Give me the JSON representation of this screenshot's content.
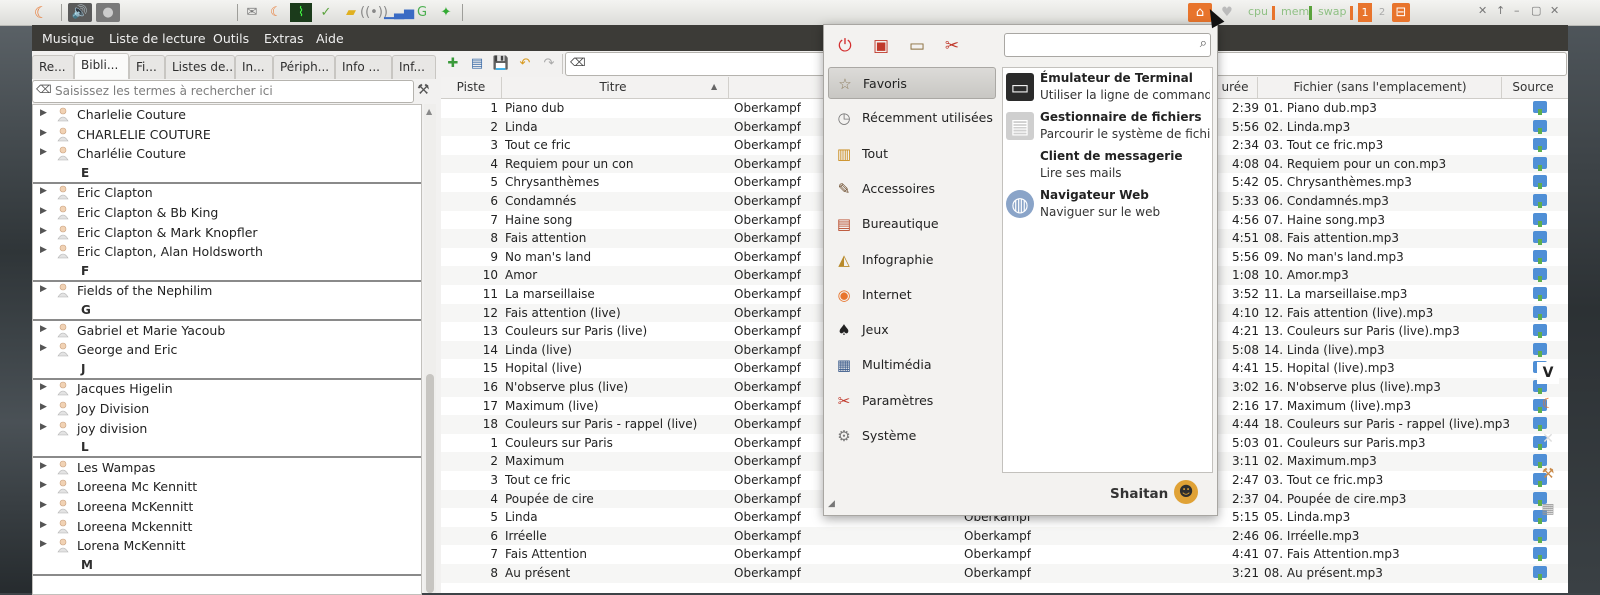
{
  "panel": {
    "cpu_label": "cpu",
    "mem_label": "mem",
    "swap_label": "swap",
    "workspace_number": "1",
    "icons": [
      "mango-icon",
      "volume-icon",
      "record-icon",
      "mail-icon",
      "system-monitor-icon",
      "shield-icon",
      "note-icon",
      "wifi-icon",
      "signal-bars-icon",
      "update-icon",
      "battery-icon"
    ]
  },
  "menubar": {
    "items": [
      "Musique",
      "Liste de lecture",
      "Outils",
      "Extras",
      "Aide"
    ]
  },
  "left": {
    "tabs": [
      "Re...",
      "Bibli...",
      "Fi...",
      "Listes de...",
      "In...",
      "Périph...",
      "Info ...",
      "Inf..."
    ],
    "search_placeholder": "Saisissez les termes à rechercher ici",
    "tree": [
      {
        "type": "artist",
        "label": "Charlelie Couture"
      },
      {
        "type": "artist",
        "label": "CHARLELIE COUTURE"
      },
      {
        "type": "artist",
        "label": "Charlélie Couture"
      },
      {
        "type": "letter",
        "label": "E"
      },
      {
        "type": "artist",
        "label": "Eric Clapton"
      },
      {
        "type": "artist",
        "label": "Eric Clapton & Bb King"
      },
      {
        "type": "artist",
        "label": "Eric Clapton & Mark Knopfler"
      },
      {
        "type": "artist",
        "label": "Eric Clapton, Alan Holdsworth"
      },
      {
        "type": "letter",
        "label": "F"
      },
      {
        "type": "artist",
        "label": "Fields of the Nephilim"
      },
      {
        "type": "letter",
        "label": "G"
      },
      {
        "type": "artist",
        "label": "Gabriel et Marie Yacoub"
      },
      {
        "type": "artist",
        "label": "George and Eric"
      },
      {
        "type": "letter",
        "label": "J"
      },
      {
        "type": "artist",
        "label": "Jacques Higelin"
      },
      {
        "type": "artist",
        "label": "Joy Division"
      },
      {
        "type": "artist",
        "label": "joy division"
      },
      {
        "type": "letter",
        "label": "L"
      },
      {
        "type": "artist",
        "label": "Les Wampas"
      },
      {
        "type": "artist",
        "label": "Loreena Mc Kennitt"
      },
      {
        "type": "artist",
        "label": "Loreena McKennitt"
      },
      {
        "type": "artist",
        "label": "Loreena Mckennitt"
      },
      {
        "type": "artist",
        "label": "Lorena McKennitt"
      },
      {
        "type": "letter",
        "label": "M"
      }
    ]
  },
  "grid": {
    "columns": {
      "track": "Piste",
      "title": "Titre",
      "duration": "urée",
      "file": "Fichier (sans l'emplacement)",
      "source": "Source"
    },
    "sorted_column": "Titre",
    "rows": [
      {
        "n": "1",
        "title": "Piano dub",
        "artist": "Oberkampf",
        "album": "",
        "dur": "2:39",
        "file": "01. Piano dub.mp3"
      },
      {
        "n": "2",
        "title": "Linda",
        "artist": "Oberkampf",
        "album": "",
        "dur": "5:56",
        "file": "02. Linda.mp3"
      },
      {
        "n": "3",
        "title": "Tout ce fric",
        "artist": "Oberkampf",
        "album": "",
        "dur": "2:34",
        "file": "03. Tout ce fric.mp3"
      },
      {
        "n": "4",
        "title": "Requiem pour un con",
        "artist": "Oberkampf",
        "album": "",
        "dur": "4:08",
        "file": "04. Requiem pour un con.mp3"
      },
      {
        "n": "5",
        "title": "Chrysanthèmes",
        "artist": "Oberkampf",
        "album": "",
        "dur": "5:42",
        "file": "05. Chrysanthèmes.mp3"
      },
      {
        "n": "6",
        "title": "Condamnés",
        "artist": "Oberkampf",
        "album": "",
        "dur": "5:33",
        "file": "06. Condamnés.mp3"
      },
      {
        "n": "7",
        "title": "Haine song",
        "artist": "Oberkampf",
        "album": "",
        "dur": "4:56",
        "file": "07. Haine song.mp3"
      },
      {
        "n": "8",
        "title": "Fais attention",
        "artist": "Oberkampf",
        "album": "",
        "dur": "4:51",
        "file": "08. Fais attention.mp3"
      },
      {
        "n": "9",
        "title": "No man's land",
        "artist": "Oberkampf",
        "album": "",
        "dur": "5:56",
        "file": "09. No man's land.mp3"
      },
      {
        "n": "10",
        "title": "Amor",
        "artist": "Oberkampf",
        "album": "",
        "dur": "1:08",
        "file": "10. Amor.mp3"
      },
      {
        "n": "11",
        "title": "La marseillaise",
        "artist": "Oberkampf",
        "album": "",
        "dur": "3:52",
        "file": "11. La marseillaise.mp3"
      },
      {
        "n": "12",
        "title": "Fais attention (live)",
        "artist": "Oberkampf",
        "album": "",
        "dur": "4:10",
        "file": "12. Fais attention (live).mp3"
      },
      {
        "n": "13",
        "title": "Couleurs sur Paris (live)",
        "artist": "Oberkampf",
        "album": "",
        "dur": "4:21",
        "file": "13. Couleurs sur Paris (live).mp3"
      },
      {
        "n": "14",
        "title": "Linda (live)",
        "artist": "Oberkampf",
        "album": "",
        "dur": "5:08",
        "file": "14. Linda (live).mp3"
      },
      {
        "n": "15",
        "title": "Hopital (live)",
        "artist": "Oberkampf",
        "album": "",
        "dur": "4:41",
        "file": "15. Hopital (live).mp3"
      },
      {
        "n": "16",
        "title": "N'observe plus (live)",
        "artist": "Oberkampf",
        "album": "",
        "dur": "3:02",
        "file": "16. N'observe plus (live).mp3"
      },
      {
        "n": "17",
        "title": "Maximum (live)",
        "artist": "Oberkampf",
        "album": "",
        "dur": "2:16",
        "file": "17. Maximum (live).mp3"
      },
      {
        "n": "18",
        "title": "Couleurs sur Paris - rappel (live)",
        "artist": "Oberkampf",
        "album": "",
        "dur": "4:44",
        "file": "18. Couleurs sur Paris - rappel (live).mp3"
      },
      {
        "n": "1",
        "title": "Couleurs sur Paris",
        "artist": "Oberkampf",
        "album": "",
        "dur": "5:03",
        "file": "01. Couleurs sur Paris.mp3"
      },
      {
        "n": "2",
        "title": "Maximum",
        "artist": "Oberkampf",
        "album": "",
        "dur": "3:11",
        "file": "02. Maximum.mp3"
      },
      {
        "n": "3",
        "title": "Tout ce fric",
        "artist": "Oberkampf",
        "album": "",
        "dur": "2:47",
        "file": "03. Tout ce fric.mp3"
      },
      {
        "n": "4",
        "title": "Poupée de cire",
        "artist": "Oberkampf",
        "album": "",
        "dur": "2:37",
        "file": "04. Poupée de cire.mp3"
      },
      {
        "n": "5",
        "title": "Linda",
        "artist": "Oberkampf",
        "album": "Oberkampf",
        "dur": "5:15",
        "file": "05. Linda.mp3"
      },
      {
        "n": "6",
        "title": "Irréelle",
        "artist": "Oberkampf",
        "album": "Oberkampf",
        "dur": "2:46",
        "file": "06. Irréelle.mp3"
      },
      {
        "n": "7",
        "title": "Fais Attention",
        "artist": "Oberkampf",
        "album": "Oberkampf",
        "dur": "4:41",
        "file": "07. Fais Attention.mp3"
      },
      {
        "n": "8",
        "title": "Au présent",
        "artist": "Oberkampf",
        "album": "Oberkampf",
        "dur": "3:21",
        "file": "08. Au présent.mp3"
      }
    ]
  },
  "launcher": {
    "categories": [
      {
        "label": "Favoris",
        "icon": "star-icon",
        "selected": true
      },
      {
        "label": "Récemment utilisées",
        "icon": "clock-icon",
        "selected": false
      },
      {
        "label": "Tout",
        "icon": "all-apps-icon",
        "selected": false
      },
      {
        "label": "Accessoires",
        "icon": "accessories-icon",
        "selected": false
      },
      {
        "label": "Bureautique",
        "icon": "office-icon",
        "selected": false
      },
      {
        "label": "Infographie",
        "icon": "graphics-icon",
        "selected": false
      },
      {
        "label": "Internet",
        "icon": "internet-icon",
        "selected": false
      },
      {
        "label": "Jeux",
        "icon": "games-icon",
        "selected": false
      },
      {
        "label": "Multimédia",
        "icon": "multimedia-icon",
        "selected": false
      },
      {
        "label": "Paramètres",
        "icon": "settings-icon",
        "selected": false
      },
      {
        "label": "Système",
        "icon": "system-icon",
        "selected": false
      }
    ],
    "apps": [
      {
        "name": "Émulateur de Terminal",
        "desc": "Utiliser la ligne de commande",
        "icon": "terminal-icon"
      },
      {
        "name": "Gestionnaire de fichiers",
        "desc": "Parcourir le système de fichi...",
        "icon": "file-manager-icon"
      },
      {
        "name": "Client de messagerie",
        "desc": "Lire ses mails",
        "icon": "mail-client-icon"
      },
      {
        "name": "Navigateur Web",
        "desc": "Naviguer sur le web",
        "icon": "web-browser-icon"
      }
    ],
    "user_name": "Shaitan",
    "search_value": ""
  },
  "colors": {
    "menubar_bg": "#3c3b37",
    "panel_accent": "#e8742c",
    "selection": "#c8c7c3"
  }
}
